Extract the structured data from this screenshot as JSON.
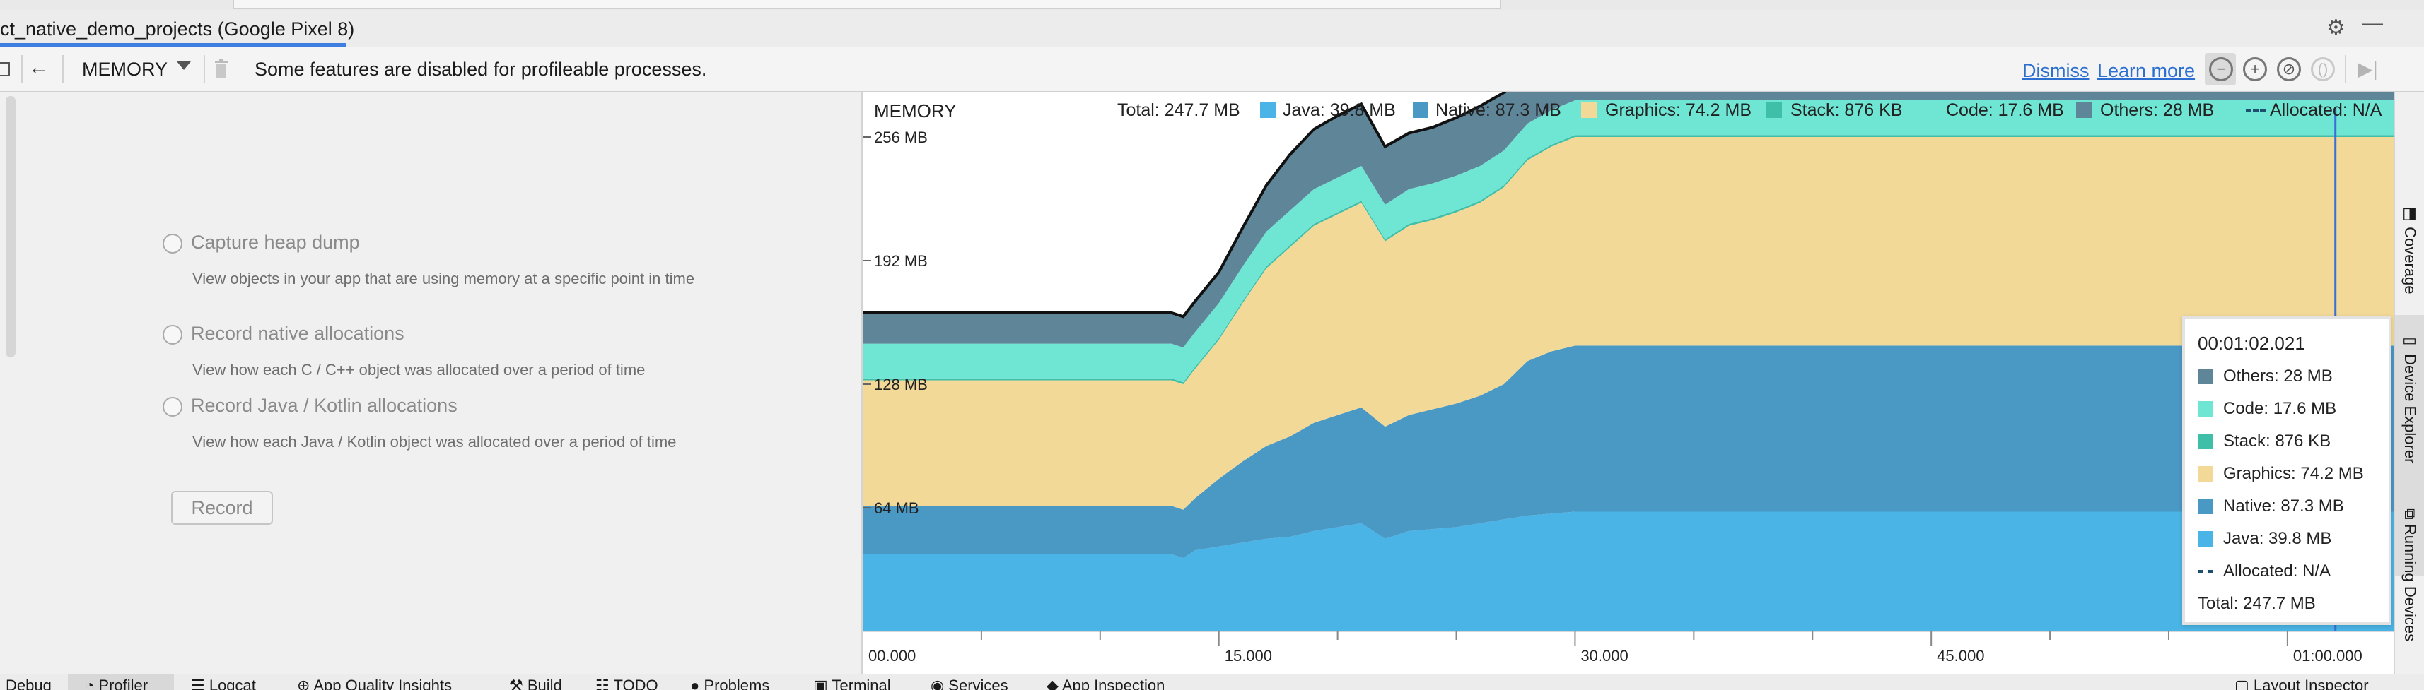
{
  "window": {
    "title": "ct_native_demo_projects (Google Pixel 8)"
  },
  "toolbar": {
    "profiler_mode": "MEMORY",
    "notice": "Some features are disabled for profileable processes.",
    "dismiss_label": "Dismiss",
    "learn_more_label": "Learn more"
  },
  "left_panel": {
    "options": [
      {
        "label": "Capture heap dump",
        "description": "View objects in your app that are using memory at a specific point in time"
      },
      {
        "label": "Record native allocations",
        "description": "View how each C / C++ object was allocated over a period of time"
      },
      {
        "label": "Record Java / Kotlin allocations",
        "description": "View how each Java / Kotlin object was allocated over a period of time"
      }
    ],
    "record_label": "Record"
  },
  "legend": {
    "total": "Total: 247.7 MB",
    "java": "Java: 39.8 MB",
    "native": "Native: 87.3 MB",
    "graphics": "Graphics: 74.2 MB",
    "stack": "Stack: 876 KB",
    "code": "Code: 17.6 MB",
    "others": "Others: 28 MB",
    "allocated": "Allocated: N/A"
  },
  "tooltip": {
    "time": "00:01:02.021",
    "others": "Others: 28 MB",
    "code": "Code: 17.6 MB",
    "stack": "Stack: 876 KB",
    "graphics": "Graphics: 74.2 MB",
    "native": "Native: 87.3 MB",
    "java": "Java: 39.8 MB",
    "allocated": "Allocated: N/A",
    "total": "Total: 247.7 MB"
  },
  "colors": {
    "java": "#4ab4e6",
    "native": "#4a98c4",
    "graphics": "#f2d998",
    "stack": "#3fbfa8",
    "code": "#6fe6d4",
    "others": "#5f8599",
    "allocated": "#1e4f6e",
    "accent": "#2c6fd1"
  },
  "chart_data": {
    "type": "area",
    "title": "MEMORY",
    "ylim": [
      0,
      256
    ],
    "yticks": [
      "64 MB",
      "128 MB",
      "192 MB",
      "256 MB"
    ],
    "xticks": [
      "00.000",
      "15.000",
      "30.000",
      "45.000",
      "01:00.000"
    ],
    "x": [
      0,
      13,
      13.5,
      14,
      15,
      16,
      17,
      18,
      19,
      20,
      21,
      22,
      23,
      24,
      25,
      26,
      27,
      28,
      29,
      30,
      35,
      40,
      45,
      50,
      55,
      60,
      62.5
    ],
    "series": [
      {
        "name": "Java",
        "values": [
          40,
          40,
          38,
          42,
          44,
          46,
          48,
          49,
          52,
          54,
          56,
          48,
          52,
          53,
          54,
          56,
          58,
          60,
          61,
          62,
          62,
          62,
          62,
          62,
          62,
          62,
          62
        ]
      },
      {
        "name": "Native",
        "values": [
          25,
          25,
          25,
          27,
          35,
          42,
          48,
          52,
          56,
          58,
          60,
          58,
          60,
          62,
          64,
          66,
          70,
          80,
          84,
          86,
          86,
          86,
          86,
          86,
          86,
          86,
          86
        ]
      },
      {
        "name": "Graphics",
        "values": [
          65,
          65,
          65,
          67,
          72,
          82,
          92,
          98,
          102,
          104,
          106,
          96,
          98,
          98,
          99,
          100,
          102,
          104,
          106,
          108,
          108,
          108,
          108,
          108,
          108,
          108,
          108
        ]
      },
      {
        "name": "Stack",
        "values": [
          1,
          1,
          1,
          1,
          1,
          1,
          1,
          1,
          1,
          1,
          1,
          1,
          1,
          1,
          1,
          1,
          1,
          1,
          1,
          1,
          1,
          1,
          1,
          1,
          1,
          1,
          1
        ]
      },
      {
        "name": "Code",
        "values": [
          18,
          18,
          18,
          18,
          18,
          18,
          18,
          18,
          18,
          18,
          18,
          18,
          18,
          18,
          18,
          18,
          18,
          18,
          18,
          18,
          18,
          18,
          18,
          18,
          18,
          18,
          18
        ]
      },
      {
        "name": "Others",
        "values": [
          16,
          16,
          16,
          16,
          16,
          20,
          24,
          29,
          31,
          32,
          32,
          30,
          29,
          29,
          30,
          31,
          30,
          30,
          28,
          36,
          37,
          37,
          35,
          36,
          36,
          36,
          36
        ]
      }
    ],
    "cursor_time": "00:01:02.021",
    "legend_position": "top"
  }
}
